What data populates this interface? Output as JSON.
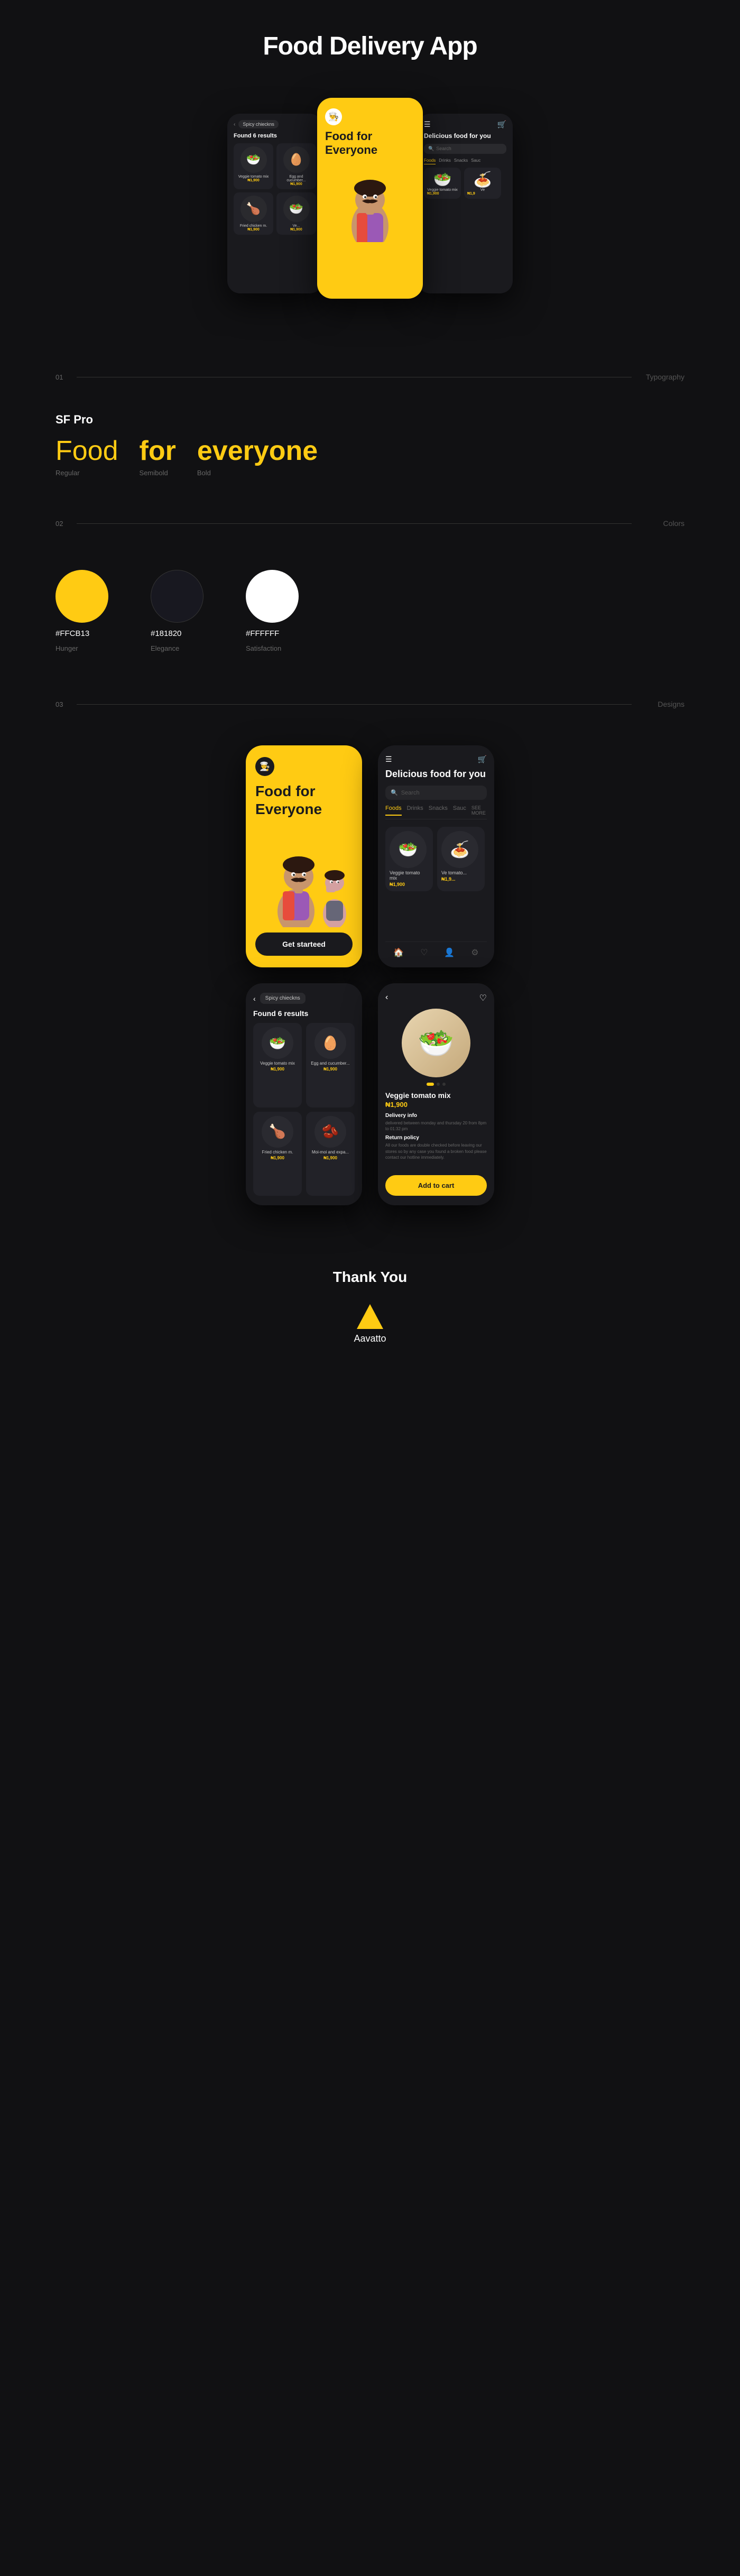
{
  "page": {
    "title": "Food Delivery App"
  },
  "header": {
    "title": "Food Delivery App"
  },
  "hero": {
    "center_phone": {
      "title": "Food for Everyone",
      "chef_emoji": "👨‍🍳"
    },
    "left_phone": {
      "search_tag": "Spicy chieckns",
      "results_text": "Found 6 results",
      "foods": [
        {
          "name": "Veggie tomato mix",
          "price": "₦1,900",
          "emoji": "🥗"
        },
        {
          "name": "Egg and cucumber...",
          "price": "₦1,900",
          "emoji": "🥚"
        },
        {
          "name": "Fried chicken m.",
          "price": "₦1,900",
          "emoji": "🍗"
        },
        {
          "name": "Ve...",
          "price": "₦1,900",
          "emoji": "🥗"
        }
      ]
    },
    "right_phone": {
      "title": "Delicious food for you",
      "search_placeholder": "Search",
      "categories": [
        "Foods",
        "Drinks",
        "Snacks",
        "Sauc"
      ],
      "active_category": "Foods"
    }
  },
  "section01": {
    "number": "01",
    "label": "Typography"
  },
  "typography": {
    "font_name": "SF Pro",
    "words": [
      {
        "text": "Food",
        "style": "Regular",
        "weight": "regular"
      },
      {
        "text": "for",
        "style": "Semibold",
        "weight": "semibold"
      },
      {
        "text": "everyone",
        "style": "Bold",
        "weight": "bold"
      }
    ]
  },
  "section02": {
    "number": "02",
    "label": "Colors"
  },
  "colors": {
    "swatches": [
      {
        "hex": "#FFCB13",
        "name": "Hunger",
        "color": "#FFCB13"
      },
      {
        "hex": "#181820",
        "name": "Elegance",
        "color": "#181820"
      },
      {
        "hex": "#FFFFFF",
        "name": "Satisfaction",
        "color": "#FFFFFF"
      }
    ]
  },
  "section03": {
    "number": "03",
    "label": "Designs"
  },
  "designs": {
    "yellow_phone": {
      "title": "Food for Everyone",
      "get_started": "Get starteed"
    },
    "dark_phone1": {
      "title": "Delicious food for you",
      "search_placeholder": "Search",
      "categories": [
        "Foods",
        "Drinks",
        "Snacks",
        "Sauc"
      ],
      "active": "Foods",
      "see_more": "SEE MORE",
      "foods": [
        {
          "name": "Veggie tomato mix",
          "price": "₦1,900",
          "emoji": "🥗"
        },
        {
          "name": "Ve tomato...",
          "price": "₦1,9...",
          "emoji": "🍝"
        }
      ]
    },
    "search_phone": {
      "back": "‹",
      "search_tag": "Spicy chieckns",
      "results": "Found 6 results",
      "foods": [
        {
          "name": "Veggie tomato mix",
          "price": "₦1,900",
          "emoji": "🥗"
        },
        {
          "name": "Egg and cucumber...",
          "price": "₦1,900",
          "emoji": "🥚"
        },
        {
          "name": "Fried chicken m.",
          "price": "₦1,900",
          "emoji": "🍗"
        },
        {
          "name": "Moi-moi and expa...",
          "price": "₦1,900",
          "emoji": "🫘"
        }
      ]
    },
    "detail_phone": {
      "back": "‹",
      "food_name": "Veggie tomato mix",
      "price": "₦1,900",
      "delivery_title": "Delivery info",
      "delivery_text": "delivered between monday and thursday 20 from 8pm to 01:32 pm",
      "return_title": "Return policy",
      "return_text": "All our foods are double checked before leaving our stores so by any case you found a broken food please contact our hotline immediately.",
      "add_to_cart": "Add to cart",
      "emoji": "🥗"
    }
  },
  "footer": {
    "thank_you": "Thank You",
    "logo_name": "Aavatto"
  }
}
